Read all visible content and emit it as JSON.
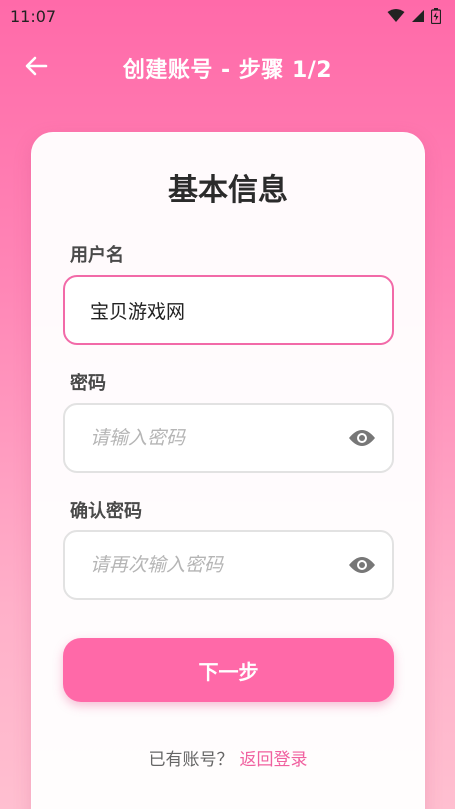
{
  "status_bar": {
    "time": "11:07"
  },
  "app_bar": {
    "title": "创建账号 - 步骤 1/2"
  },
  "card": {
    "title": "基本信息"
  },
  "form": {
    "username": {
      "label": "用户名",
      "value": "宝贝游戏网",
      "placeholder": ""
    },
    "password": {
      "label": "密码",
      "value": "",
      "placeholder": "请输入密码"
    },
    "confirm_password": {
      "label": "确认密码",
      "value": "",
      "placeholder": "请再次输入密码"
    }
  },
  "next_button": {
    "label": "下一步"
  },
  "footer": {
    "prompt": "已有账号？",
    "link": "返回登录"
  },
  "colors": {
    "accent": "#ff69a8",
    "active_border": "#f26aa8",
    "link": "#f0609f"
  }
}
